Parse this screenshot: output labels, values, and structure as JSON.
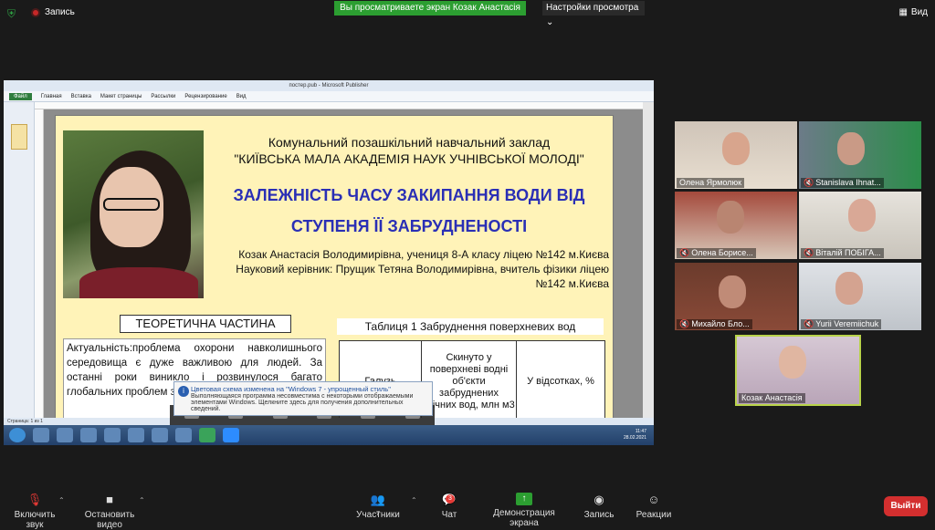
{
  "topbar": {
    "record_label": "Запись",
    "share_banner": "Вы просматриваете экран Козак Анастасія",
    "view_options": "Настройки просмотра",
    "view_button": "Вид"
  },
  "publisher": {
    "window_title": "постер.pub - Microsoft Publisher",
    "ribbon_tabs": [
      "Файл",
      "Главная",
      "Вставка",
      "Макет страницы",
      "Рассылки",
      "Рецензирование",
      "Вид"
    ],
    "status_text": "Страница: 1 из 1",
    "clock_time": "11:47",
    "clock_date": "28.02.2021"
  },
  "poster": {
    "institution_line1": "Комунальний позашкільний навчальний заклад",
    "institution_line2": "\"КИЇВСЬКА МАЛА АКАДЕМІЯ НАУК УЧНІВСЬКОЇ МОЛОДІ\"",
    "title_line1": "ЗАЛЕЖНІСТЬ ЧАСУ ЗАКИПАННЯ ВОДИ ВІД",
    "title_line2": "СТУПЕНЯ ЇЇ ЗАБРУДНЕНОСТІ",
    "author_line1": "Козак Анастасія Володимирівна, учениця 8-А класу ліцею №142 м.Києва",
    "author_line2": "Науковий керівник: Прущик Тетяна Володимирівна, вчитель фізики ліцею",
    "author_line3": "№142 м.Києва",
    "section_heading": "ТЕОРЕТИЧНА ЧАСТИНА",
    "body_text": "Актуальність:проблема охорони навколишнього середовища є дуже важливою для людей. За останні роки виникло і розвинулося багато глобальних проблем з цієї... Мета: визначити за...",
    "table_title": "Таблиця 1  Забруднення поверхневих вод",
    "table_headers": [
      "Галузь",
      "Скинуто у поверхневі водні об'єкти забруднених стічних вод, млн м3",
      "У відсотках, %"
    ]
  },
  "toast": {
    "title": "Цветовая схема изменена на \"Windows 7 - упрощенный стиль\"",
    "body": "Выполняющаяся программа несовместима с некоторыми отображаемыми элементами Windows. Щелкните здесь для получения дополнительных сведений."
  },
  "participants": [
    {
      "name": "Олена Ярмолюк",
      "muted": false
    },
    {
      "name": "Stanislava Ihnat...",
      "muted": true
    },
    {
      "name": "Олена Борисе...",
      "muted": true
    },
    {
      "name": "Віталій ПОБІГА...",
      "muted": true
    },
    {
      "name": "Михайло Бло...",
      "muted": true
    },
    {
      "name": "Yurii Veremiichuk",
      "muted": true
    },
    {
      "name": "Козак Анастасія",
      "muted": false
    }
  ],
  "toolbar": {
    "audio": "Включить звук",
    "video": "Остановить видео",
    "participants": "Участники",
    "participants_count": "7",
    "chat": "Чат",
    "chat_badge": "3",
    "share": "Демонстрация экрана",
    "record": "Запись",
    "reactions": "Реакции",
    "leave": "Выйти"
  }
}
